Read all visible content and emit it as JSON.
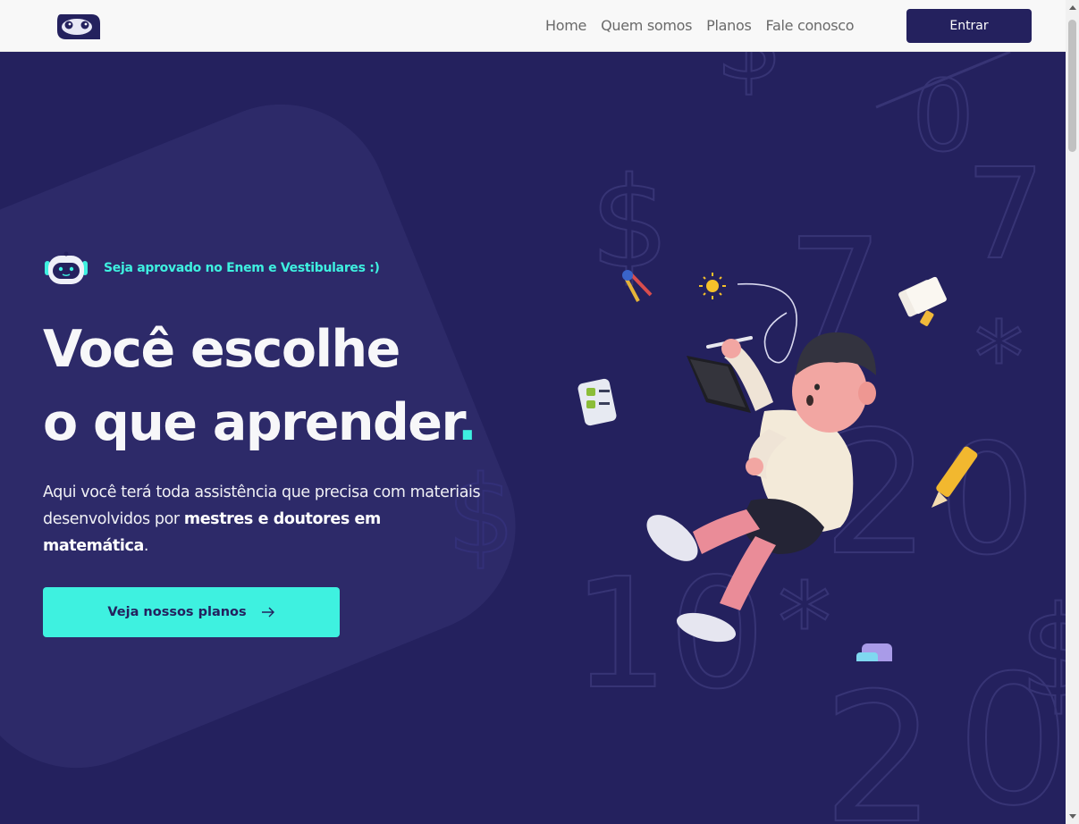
{
  "header": {
    "logo_icon": "robot-face-icon",
    "nav": [
      {
        "label": "Home"
      },
      {
        "label": "Quem somos"
      },
      {
        "label": "Planos"
      },
      {
        "label": "Fale conosco"
      }
    ],
    "login_label": "Entrar"
  },
  "hero": {
    "tag_icon": "robot-mascot-icon",
    "tag_text": "Seja aprovado no Enem e Vestibulares :)",
    "headline_line1": "Você escolhe",
    "headline_line2": "o que aprender",
    "headline_dot": ".",
    "description_part1": "Aqui você terá toda assistência que precisa com materiais desenvolvidos por ",
    "description_bold": "mestres e doutores em matemática",
    "description_end": ".",
    "cta_label": "Veja nossos planos",
    "cta_icon": "arrow-right-icon",
    "illustration": "boy-floating-with-tablet-illustration"
  },
  "colors": {
    "primary": "#24215e",
    "accent": "#3ef1e0",
    "header_bg": "#f8f8f8"
  }
}
